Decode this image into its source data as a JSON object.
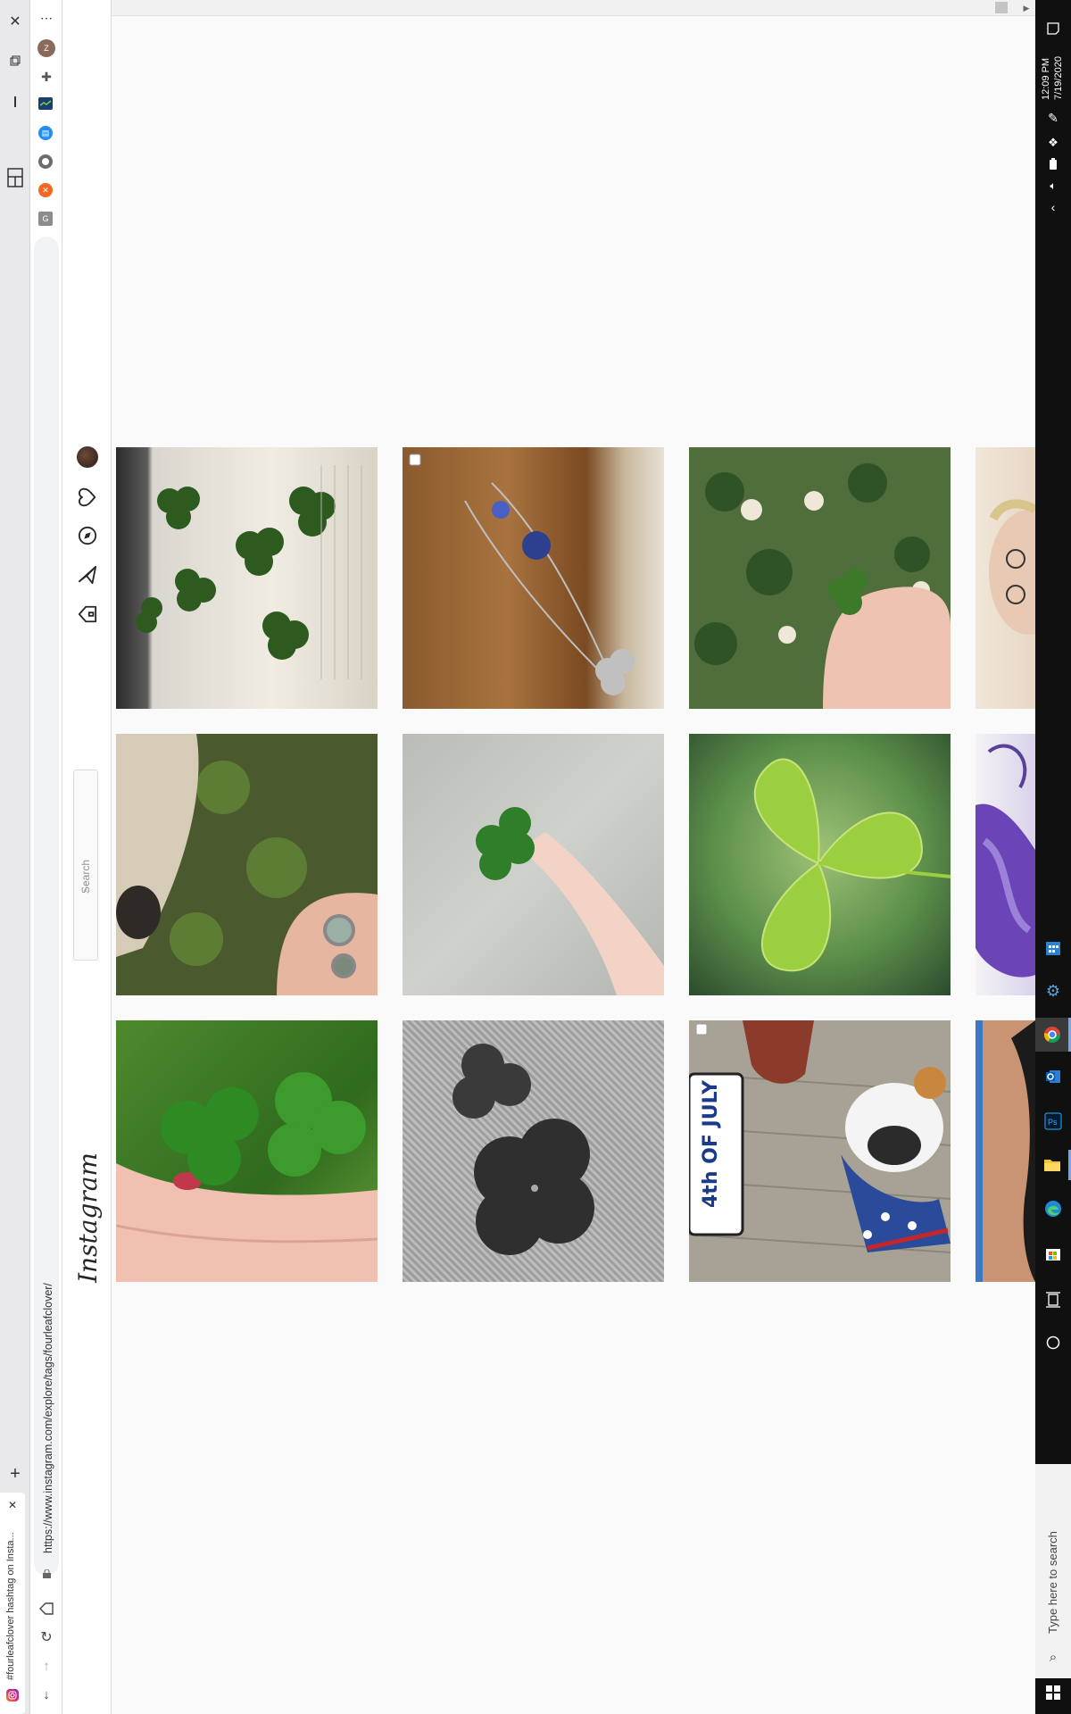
{
  "browser": {
    "tab_title": "#fourleafclover hashtag on Insta...",
    "url": "https://www.instagram.com/explore/tags/fourleafclover/",
    "new_tab_label": "+"
  },
  "instagram": {
    "logo": "Instagram",
    "search_placeholder": "Search"
  },
  "taskbar": {
    "time": "12:09 PM",
    "date": "7/19/2020",
    "search_placeholder": "Type here to search"
  },
  "overlays": {
    "fourth_of_july_text": "4th OF JULY"
  },
  "colors": {
    "accent_green": "#4d8f2c",
    "ig_text": "#262626",
    "taskbar_bg": "#101010"
  },
  "posts": [
    {
      "name": "post-clovers-in-book",
      "description_icon": "clover-book-image"
    },
    {
      "name": "post-clover-necklace",
      "description_icon": "necklace-image"
    },
    {
      "name": "post-clover-in-grass",
      "description_icon": "clover-grass-image"
    },
    {
      "name": "post-pug-clover",
      "description_icon": "pug-image"
    },
    {
      "name": "post-hand-clover",
      "description_icon": "hand-clover-image"
    },
    {
      "name": "post-clover-leaf-closeup",
      "description_icon": "leaf-closeup-image"
    },
    {
      "name": "post-clovers-on-fingers",
      "description_icon": "clover-fingers-image"
    },
    {
      "name": "post-bw-clovers",
      "description_icon": "bw-clover-image"
    },
    {
      "name": "post-dog-4th-july",
      "description_icon": "dog-image"
    }
  ]
}
